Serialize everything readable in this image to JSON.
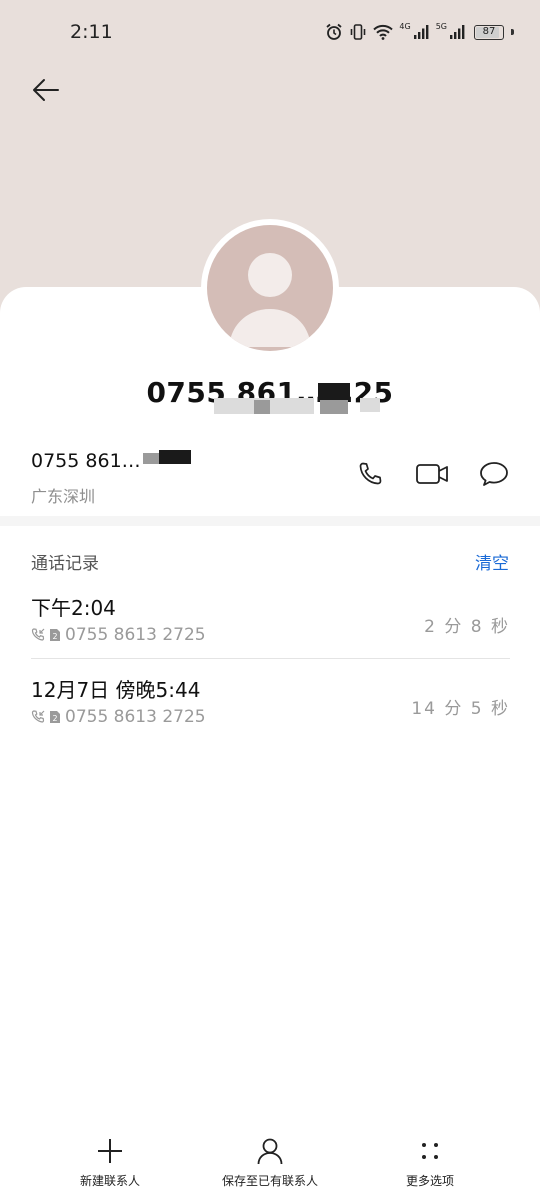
{
  "status_bar": {
    "time": "2:11",
    "network_4g": "4G",
    "network_5g": "5G",
    "battery": "87",
    "battery_level": 0.87
  },
  "contact": {
    "name": "0755 861……25",
    "number": "0755 861…",
    "location": "广东深圳"
  },
  "call_log": {
    "title": "通话记录",
    "clear_label": "清空",
    "items": [
      {
        "time": "下午2:04",
        "number": "0755 8613 2725",
        "duration": "2 分 8 秒"
      },
      {
        "time": "12月7日 傍晚5:44",
        "number": "0755 8613 2725",
        "duration": "14 分 5 秒"
      }
    ]
  },
  "bottom_bar": {
    "new_contact": "新建联系人",
    "save_existing": "保存至已有联系人",
    "more_options": "更多选项"
  },
  "colors": {
    "header_bg": "#e8dfdb",
    "avatar_bg": "#d4bdb7",
    "accent": "#1a6ad6"
  }
}
